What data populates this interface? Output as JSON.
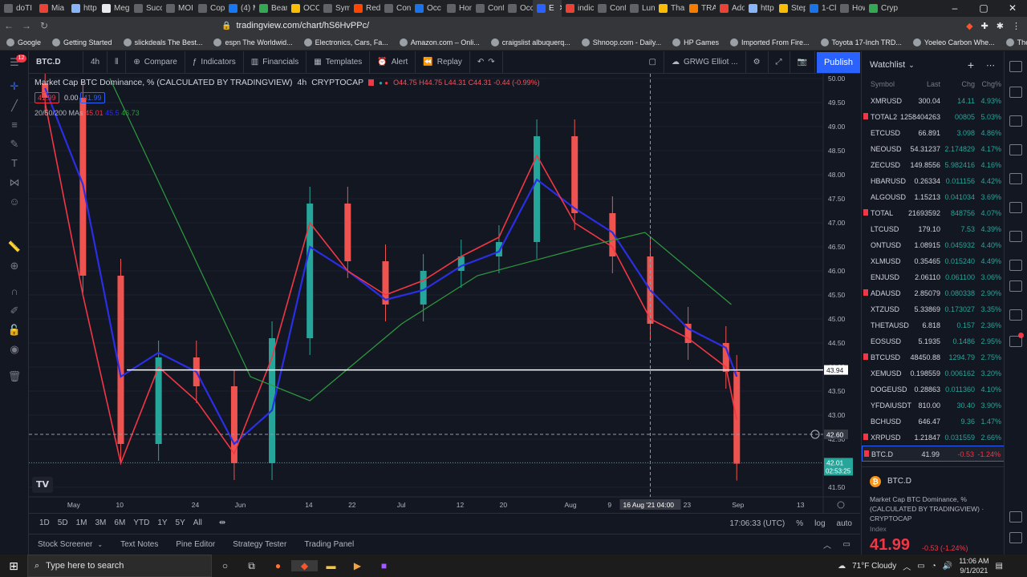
{
  "browser": {
    "tabs": [
      {
        "label": "doTI",
        "color": "#5f6368",
        "w": 44
      },
      {
        "label": "Mia",
        "color": "#ea4335",
        "w": 40
      },
      {
        "label": "http",
        "color": "#8ab4f8",
        "w": 38
      },
      {
        "label": "Meg",
        "color": "#e8eaed",
        "w": 40
      },
      {
        "label": "Succ",
        "color": "#5f6368",
        "w": 40
      },
      {
        "label": "MOI",
        "color": "#5f6368",
        "w": 40
      },
      {
        "label": "Copi",
        "color": "#5f6368",
        "w": 38
      },
      {
        "label": "(4) M",
        "color": "#1877f2",
        "w": 38
      },
      {
        "label": "Bean",
        "color": "#34a853",
        "w": 40
      },
      {
        "label": "OCC",
        "color": "#fbbc04",
        "w": 40
      },
      {
        "label": "Sym",
        "color": "#5f6368",
        "w": 38
      },
      {
        "label": "Red",
        "color": "#ff4500",
        "w": 38
      },
      {
        "label": "Conf",
        "color": "#5f6368",
        "w": 38
      },
      {
        "label": "Occ",
        "color": "#1a73e8",
        "w": 40
      },
      {
        "label": "Hon",
        "color": "#5f6368",
        "w": 36
      },
      {
        "label": "Conf",
        "color": "#5f6368",
        "w": 40
      },
      {
        "label": "Occ",
        "color": "#5f6368",
        "w": 36
      },
      {
        "label": "E",
        "color": "#2962ff",
        "w": 36,
        "active": true
      },
      {
        "label": "indic",
        "color": "#ea4335",
        "w": 40
      },
      {
        "label": "Conf",
        "color": "#5f6368",
        "w": 40
      },
      {
        "label": "Lunc",
        "color": "#5f6368",
        "w": 36
      },
      {
        "label": "Than",
        "color": "#fbbc04",
        "w": 38
      },
      {
        "label": "TRAI",
        "color": "#f57c00",
        "w": 38
      },
      {
        "label": "Ado",
        "color": "#ea4335",
        "w": 36
      },
      {
        "label": "http",
        "color": "#8ab4f8",
        "w": 38
      },
      {
        "label": "Step",
        "color": "#fbbc04",
        "w": 38
      },
      {
        "label": "1-Cli",
        "color": "#1a73e8",
        "w": 38
      },
      {
        "label": "How",
        "color": "#5f6368",
        "w": 36
      },
      {
        "label": "Cryp",
        "color": "#34a853",
        "w": 42
      }
    ],
    "url": "tradingview.com/chart/hS6HvPPc/",
    "bookmarks": [
      "Google",
      "Getting Started",
      "slickdeals The Best...",
      "espn The Worldwid...",
      "Electronics, Cars, Fa...",
      "Amazon.com – Onli...",
      "craigslist albuquerq...",
      "Shnoop.com - Daily...",
      "HP Games",
      "Imported From Fire...",
      "Toyota 17-Inch TRD...",
      "Yoeleo Carbon Whe...",
      "The Importance of..."
    ]
  },
  "toolbar": {
    "symbol": "BTC.D",
    "interval": "4h",
    "compare": "Compare",
    "indicators": "Indicators",
    "financials": "Financials",
    "templates": "Templates",
    "alert": "Alert",
    "replay": "Replay",
    "layout": "GRWG Elliot ...",
    "publish": "Publish",
    "notif_count": "12"
  },
  "legend": {
    "title": "Market Cap BTC Dominance, % (CALCULATED BY TRADINGVIEW)",
    "interval": "4h",
    "exchange": "CRYPTOCAP",
    "ohlc": "O44.75  H44.75  L44.31  C44.31  -0.44 (-0.99%)",
    "bid": "41.99",
    "spread": "0.00",
    "ask": "41.99",
    "ma_label": "20/50/200 MAs",
    "ma20": "45.01",
    "ma50": "45.5",
    "ma200": "46.73"
  },
  "chart_data": {
    "type": "candlestick",
    "series": [
      {
        "name": "BTC.D",
        "color_up": "#26a69a",
        "color_down": "#ef5350",
        "x": [
          "2021-04-26",
          "2021-05-03",
          "2021-05-10",
          "2021-05-17",
          "2021-05-24",
          "2021-05-31",
          "2021-06-07",
          "2021-06-14",
          "2021-06-21",
          "2021-06-28",
          "2021-07-05",
          "2021-07-12",
          "2021-07-19",
          "2021-07-26",
          "2021-08-02",
          "2021-08-09",
          "2021-08-16",
          "2021-08-23",
          "2021-08-30",
          "2021-09-01"
        ],
        "y": [
          49.6,
          45.9,
          42.4,
          44.2,
          43.6,
          42.0,
          44.6,
          47.4,
          46.2,
          45.3,
          46.0,
          46.3,
          46.6,
          48.8,
          47.2,
          46.3,
          44.9,
          44.5,
          43.9,
          41.99
        ]
      }
    ],
    "ma20": [
      49.5,
      45.5,
      42.0,
      44.0,
      43.3,
      42.2,
      44.2,
      47.0,
      46.0,
      45.5,
      45.8,
      46.3,
      46.7,
      48.4,
      47.0,
      46.5,
      45.0,
      44.6,
      44.0,
      42.9
    ],
    "ma50": [
      49.8,
      47.8,
      43.8,
      44.3,
      43.9,
      42.4,
      43.1,
      46.5,
      46.0,
      45.4,
      45.6,
      46.1,
      46.4,
      47.9,
      47.3,
      46.8,
      45.6,
      44.8,
      44.4,
      43.8
    ],
    "ma200_x": [
      "2021-05-08",
      "2021-06-03",
      "2021-06-14",
      "2021-07-01",
      "2021-07-15",
      "2021-08-04",
      "2021-08-15",
      "2021-08-31"
    ],
    "ma200": [
      50.0,
      43.8,
      43.3,
      44.9,
      45.9,
      46.5,
      46.8,
      45.3
    ],
    "y_ticks": [
      "50.00",
      "49.50",
      "49.00",
      "48.50",
      "48.00",
      "47.50",
      "47.00",
      "46.50",
      "46.00",
      "45.50",
      "45.00",
      "44.50",
      "44.00",
      "43.50",
      "43.00",
      "42.50",
      "42.00",
      "41.50"
    ],
    "x_ticks": [
      "May",
      "10",
      "24",
      "Jun",
      "14",
      "22",
      "Jul",
      "12",
      "20",
      "Aug",
      "9",
      "23",
      "Sep",
      "13"
    ],
    "ylim": [
      41.3,
      50.1
    ],
    "horizontal_line": 43.94,
    "horizontal_line_label": "43.94",
    "crosshair_y": 42.6,
    "crosshair_label": "42.60",
    "crosshair_x_label": "16 Aug '21  04:00",
    "last_price_label": "42.01",
    "countdown": "02:53:25"
  },
  "timeframes": [
    "1D",
    "5D",
    "1M",
    "3M",
    "6M",
    "YTD",
    "1Y",
    "5Y",
    "All"
  ],
  "status": {
    "time": "17:06:33 (UTC)",
    "pct": "%",
    "log": "log",
    "auto": "auto"
  },
  "panels": [
    "Stock Screener",
    "Text Notes",
    "Pine Editor",
    "Strategy Tester",
    "Trading Panel"
  ],
  "watchlist": {
    "title": "Watchlist",
    "cols": {
      "symbol": "Symbol",
      "last": "Last",
      "chg": "Chg",
      "chgp": "Chg%"
    },
    "rows": [
      {
        "s": "XMRUSD",
        "l": "300.04",
        "c": "14.11",
        "p": "4.93%",
        "dir": "pos"
      },
      {
        "s": "TOTAL2",
        "l": "1258404263",
        "c": "00805",
        "p": "5.03%",
        "dir": "pos",
        "flag": true
      },
      {
        "s": "ETCUSD",
        "l": "66.891",
        "c": "3.098",
        "p": "4.86%",
        "dir": "pos"
      },
      {
        "s": "NEOUSD",
        "l": "54.31237",
        "c": "2.174829",
        "p": "4.17%",
        "dir": "pos"
      },
      {
        "s": "ZECUSD",
        "l": "149.8556",
        "c": "5.982416",
        "p": "4.16%",
        "dir": "pos"
      },
      {
        "s": "HBARUSD",
        "l": "0.26334",
        "c": "0.011156",
        "p": "4.42%",
        "dir": "pos"
      },
      {
        "s": "ALGOUSD",
        "l": "1.15213",
        "c": "0.041034",
        "p": "3.69%",
        "dir": "pos"
      },
      {
        "s": "TOTAL",
        "l": "21693592",
        "c": "848756",
        "p": "4.07%",
        "dir": "pos",
        "flag": true
      },
      {
        "s": "LTCUSD",
        "l": "179.10",
        "c": "7.53",
        "p": "4.39%",
        "dir": "pos"
      },
      {
        "s": "ONTUSD",
        "l": "1.08915",
        "c": "0.045932",
        "p": "4.40%",
        "dir": "pos"
      },
      {
        "s": "XLMUSD",
        "l": "0.35465",
        "c": "0.015240",
        "p": "4.49%",
        "dir": "pos"
      },
      {
        "s": "ENJUSD",
        "l": "2.06110",
        "c": "0.061100",
        "p": "3.06%",
        "dir": "pos"
      },
      {
        "s": "ADAUSD",
        "l": "2.85079",
        "c": "0.080338",
        "p": "2.90%",
        "dir": "pos",
        "flag": true
      },
      {
        "s": "XTZUSD",
        "l": "5.33869",
        "c": "0.173027",
        "p": "3.35%",
        "dir": "pos"
      },
      {
        "s": "THETAUSD",
        "l": "6.818",
        "c": "0.157",
        "p": "2.36%",
        "dir": "pos"
      },
      {
        "s": "EOSUSD",
        "l": "5.1935",
        "c": "0.1486",
        "p": "2.95%",
        "dir": "pos"
      },
      {
        "s": "BTCUSD",
        "l": "48450.88",
        "c": "1294.79",
        "p": "2.75%",
        "dir": "pos",
        "flag": true
      },
      {
        "s": "XEMUSD",
        "l": "0.198559",
        "c": "0.006162",
        "p": "3.20%",
        "dir": "pos"
      },
      {
        "s": "DOGEUSD",
        "l": "0.28863",
        "c": "0.011360",
        "p": "4.10%",
        "dir": "pos"
      },
      {
        "s": "YFDAIUSDT",
        "l": "810.00",
        "c": "30.40",
        "p": "3.90%",
        "dir": "pos"
      },
      {
        "s": "BCHUSD",
        "l": "646.47",
        "c": "9.36",
        "p": "1.47%",
        "dir": "pos"
      },
      {
        "s": "XRPUSD",
        "l": "1.21847",
        "c": "0.031559",
        "p": "2.66%",
        "dir": "pos",
        "flag": true
      },
      {
        "s": "BTC.D",
        "l": "41.99",
        "c": "-0.53",
        "p": "-1.24%",
        "dir": "neg",
        "flag": true,
        "sel": true
      }
    ],
    "detail": {
      "symbol": "BTC.D",
      "desc": "Market Cap BTC Dominance, % (CALCULATED BY TRADINGVIEW) · CRYPTOCAP",
      "type": "Index",
      "price": "41.99",
      "change": "-0.53 (-1.24%)"
    }
  },
  "taskbar": {
    "search_placeholder": "Type here to search",
    "weather": "71°F  Cloudy",
    "time": "11:06 AM",
    "date": "9/1/2021"
  },
  "colors": {
    "ma20": "#f23645",
    "ma50": "#2a2ee5",
    "ma200": "#2e9b3f",
    "up": "#26a69a",
    "down": "#ef5350",
    "accent": "#2962ff"
  }
}
